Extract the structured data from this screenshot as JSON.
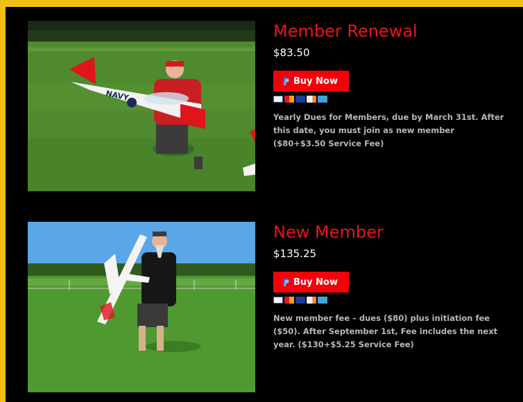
{
  "products": [
    {
      "title": "Member Renewal",
      "price": "$83.50",
      "buy_label": "Buy Now",
      "description": "Yearly Dues for Members, due by March 31st. After this date, you must join as new member ($80+$3.50 Service Fee)",
      "photo_text": "NAVY"
    },
    {
      "title": "New Member",
      "price": "$135.25",
      "buy_label": "Buy Now",
      "description": "New member fee – dues ($80) plus initiation fee ($50). After September 1st, Fee includes the next year. ($130+$5.25 Service Fee)"
    }
  ],
  "payment_cards": [
    "paypal",
    "mastercard",
    "visa",
    "discover",
    "amex"
  ],
  "colors": {
    "accent_red": "#e8151b",
    "button_red": "#f5000a",
    "frame_yellow": "#f2c012",
    "background": "#000000"
  }
}
